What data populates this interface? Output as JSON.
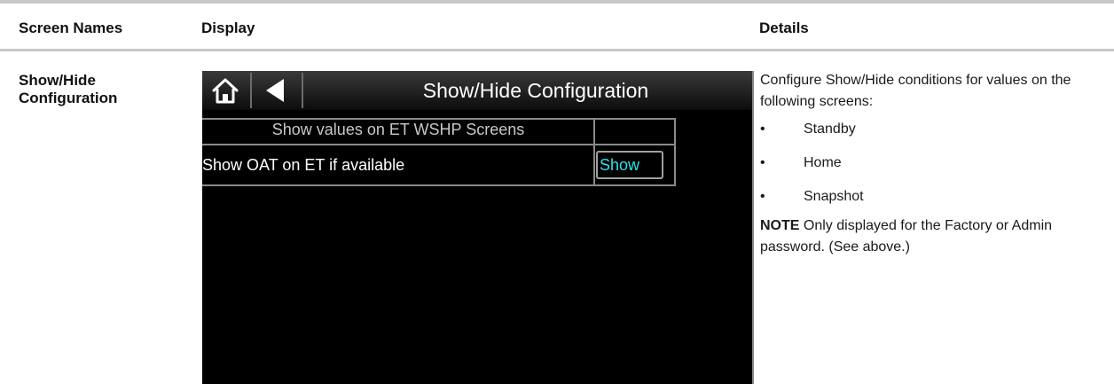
{
  "table": {
    "headers": {
      "screen_names": "Screen Names",
      "display": "Display",
      "details": "Details"
    }
  },
  "row": {
    "screen_name": "Show/Hide Configuration",
    "display": {
      "title": "Show/Hide Configuration",
      "section_label": "Show values on ET WSHP Screens",
      "item_label": "Show OAT on ET if available",
      "item_value": "Show",
      "icons": [
        "home-icon",
        "back-arrow-icon"
      ],
      "colors": {
        "background": "#000000",
        "value_text": "#2fe0ea",
        "title_text": "#ffffff"
      }
    },
    "details": {
      "intro": "Configure Show/Hide conditions for values on the following screens:",
      "bullet": "•",
      "screens": [
        "Standby",
        "Home",
        "Snapshot"
      ],
      "note_label": "NOTE",
      "note_text": " Only displayed for the Factory or Admin password. (See above.)"
    }
  }
}
